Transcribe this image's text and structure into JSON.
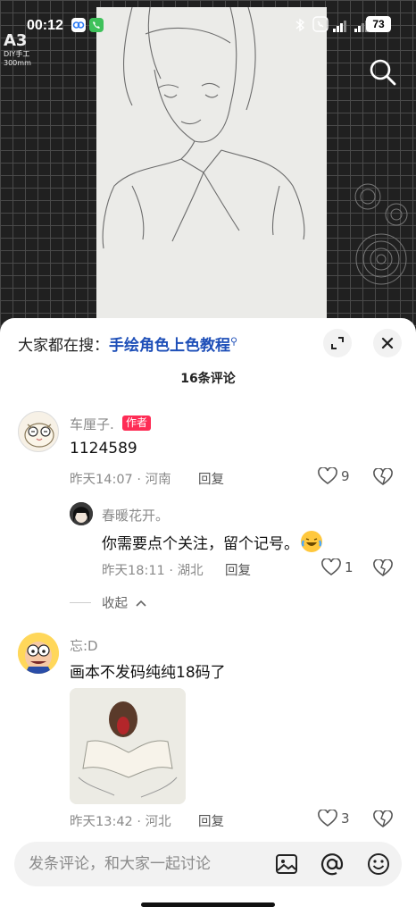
{
  "status_bar": {
    "time": "00:12",
    "battery": "73"
  },
  "video": {
    "mat_label": "A3",
    "mat_sub": "DIY手工",
    "mat_sub2": "300mm"
  },
  "sheet": {
    "trending_prefix": "大家都在搜：",
    "trending_keyword": "手绘角色上色教程",
    "comment_count": "16条评论"
  },
  "comments": [
    {
      "username": "车厘子.",
      "author_tag": "作者",
      "text": "1124589",
      "time_location": "昨天14:07 · 河南",
      "reply_label": "回复",
      "likes": "9"
    },
    {
      "username": "春暖花开。",
      "text": "你需要点个关注，留个记号。",
      "time_location": "昨天18:11 · 湖北",
      "reply_label": "回复",
      "likes": "1"
    },
    {
      "username": "忘:D",
      "text": "画本不发码纯纯18码了",
      "time_location": "昨天13:42 · 河北",
      "reply_label": "回复",
      "likes": "3"
    }
  ],
  "collapse_label": "收起",
  "input": {
    "placeholder": "发条评论，和大家一起讨论"
  },
  "colors": {
    "accent": "#fe2c55",
    "link": "#1e4fb8"
  }
}
